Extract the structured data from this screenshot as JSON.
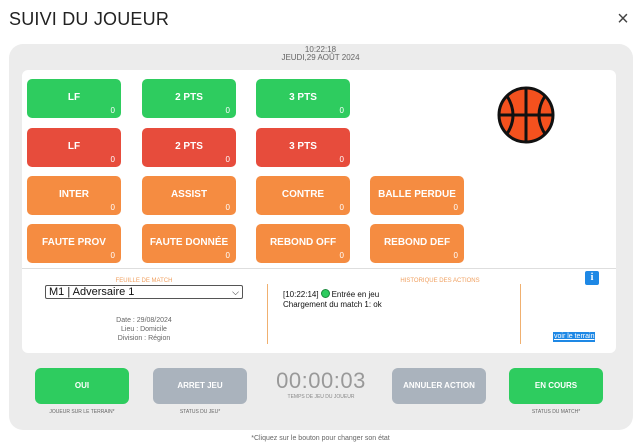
{
  "window": {
    "title": "SUIVI DU JOUEUR",
    "close_symbol": "×"
  },
  "datetime": {
    "time": "10:22:18",
    "date": "JEUDI,29 AOÛT 2024"
  },
  "score_buttons": [
    {
      "label": "LF",
      "count": "0",
      "color": "green"
    },
    {
      "label": "2 PTS",
      "count": "0",
      "color": "green"
    },
    {
      "label": "3 PTS",
      "count": "0",
      "color": "green"
    },
    {
      "label": "LF",
      "count": "0",
      "color": "red"
    },
    {
      "label": "2 PTS",
      "count": "0",
      "color": "red"
    },
    {
      "label": "3 PTS",
      "count": "0",
      "color": "red"
    },
    {
      "label": "INTER",
      "count": "0",
      "color": "orange"
    },
    {
      "label": "ASSIST",
      "count": "0",
      "color": "orange"
    },
    {
      "label": "CONTRE",
      "count": "0",
      "color": "orange"
    },
    {
      "label": "BALLE PERDUE",
      "count": "0",
      "color": "orange"
    },
    {
      "label": "FAUTE PROV",
      "count": "0",
      "color": "orange"
    },
    {
      "label": "FAUTE DONNÉE",
      "count": "0",
      "color": "orange"
    },
    {
      "label": "REBOND OFF",
      "count": "0",
      "color": "orange"
    },
    {
      "label": "REBOND DEF",
      "count": "0",
      "color": "orange"
    }
  ],
  "colors": {
    "green": "#2ecc5f",
    "red": "#e74c3c",
    "orange": "#f58c41",
    "grey": "#aab3bd",
    "blue": "#1e88e5",
    "ball": "#f4511e"
  },
  "icons": {
    "ball": "basketball-icon",
    "info": "info-icon",
    "chevron": "chevron-down-icon"
  },
  "match_sheet": {
    "label": "FEUILLE DE MATCH",
    "selected": "M1 | Adversaire 1",
    "date": "Date : 29/08/2024",
    "place": "Lieu : Domicile",
    "division": "Division : Région"
  },
  "history": {
    "label": "HISTORIQUE DES ACTIONS",
    "entry_prefix": "[10:22:14]",
    "entry_text": "Entrée en jeu",
    "entry2": "Chargement du match 1: ok"
  },
  "info_button": "i",
  "terrain_link": "voir le terrain",
  "controls": {
    "oui": "OUI",
    "oui_sub": "JOUEUR SUR LE TERRAIN*",
    "arret": "ARRET JEU",
    "arret_sub": "STATUS DU JEU*",
    "timer": "00:00:03",
    "timer_sub": "TEMPS DE JEU DU JOUEUR",
    "annuler": "ANNULER ACTION",
    "encours": "EN COURS",
    "encours_sub": "STATUS DU MATCH*"
  },
  "footnote": "*Cliquez sur le bouton pour changer son état"
}
